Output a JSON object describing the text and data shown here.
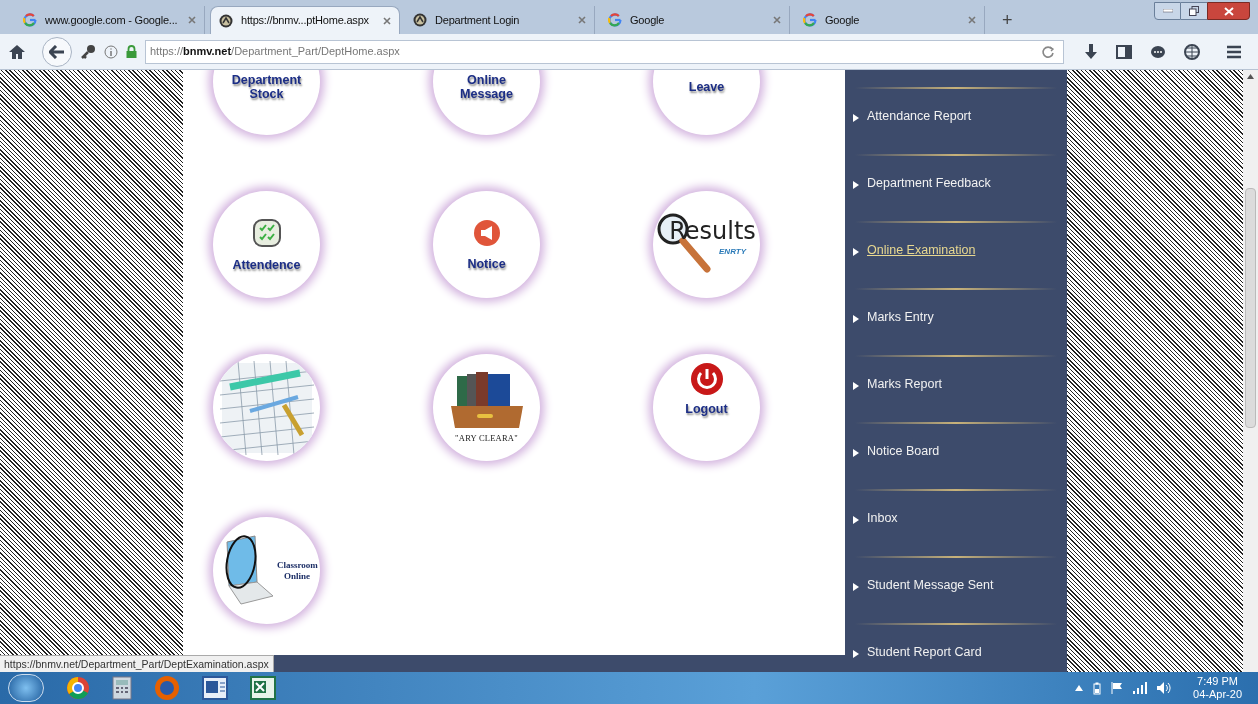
{
  "browser": {
    "tabs": [
      {
        "title": "www.google.com - Google...",
        "kind": "google",
        "selected": false
      },
      {
        "title": "https://bnmv...ptHome.aspx",
        "kind": "site",
        "selected": true
      },
      {
        "title": "Department Login",
        "kind": "site",
        "selected": false
      },
      {
        "title": "Google",
        "kind": "google",
        "selected": false
      },
      {
        "title": "Google",
        "kind": "google",
        "selected": false
      }
    ],
    "new_tab": "+",
    "url": "https://**bnmv.net**/Department_Part/DeptHome.aspx"
  },
  "tiles": [
    {
      "kind": "text",
      "label": "Department Stock"
    },
    {
      "kind": "text",
      "label": "Online Message"
    },
    {
      "kind": "text",
      "label": "Leave"
    },
    {
      "kind": "checklist",
      "label": "Attendence"
    },
    {
      "kind": "megaphone",
      "label": "Notice"
    },
    {
      "kind": "results",
      "label": "Results",
      "sublabel": "ENRTY"
    },
    {
      "kind": "sheet"
    },
    {
      "kind": "books",
      "label": "\"ARY CLEARA\""
    },
    {
      "kind": "power",
      "label": "Logout"
    },
    {
      "kind": "laptop",
      "label": "Classroom Online"
    }
  ],
  "sidebar": {
    "items": [
      {
        "label": "Attendance Report",
        "hovered": false
      },
      {
        "label": "Department Feedback",
        "hovered": false
      },
      {
        "label": "Online Examination",
        "hovered": true
      },
      {
        "label": "Marks Entry",
        "hovered": false
      },
      {
        "label": "Marks Report",
        "hovered": false
      },
      {
        "label": "Notice Board",
        "hovered": false
      },
      {
        "label": "Inbox",
        "hovered": false
      },
      {
        "label": "Student Message Sent",
        "hovered": false
      },
      {
        "label": "Student Report Card",
        "hovered": false
      }
    ]
  },
  "status_link": "https://bnmv.net/Department_Part/DeptExamination.aspx",
  "taskbar": {
    "time": "7:49 PM",
    "date": "04-Apr-20"
  }
}
